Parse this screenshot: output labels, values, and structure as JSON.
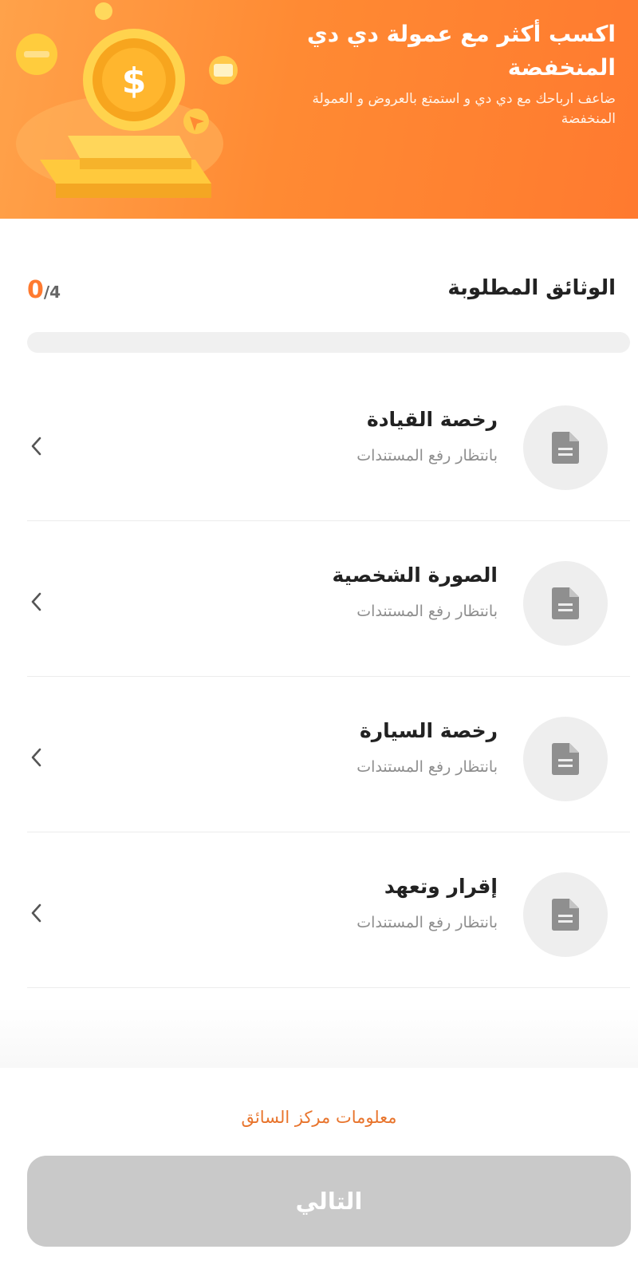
{
  "banner": {
    "title": "اكسب أكثر مع عمولة دي دي المنخفضة",
    "subtitle": "ضاعف ارباحك مع دي دي و استمتع بالعروض و العمولة المنخفضة",
    "illustration": "coin-dollar-illustration",
    "colors": {
      "gradient_start": "#ffa24a",
      "gradient_end": "#ff7a2f"
    }
  },
  "requirements": {
    "title": "الوثائق المطلوبة",
    "completed": "0",
    "total": "/4",
    "progress_fraction": 0
  },
  "documents": [
    {
      "title": "رخصة القيادة",
      "status": "بانتظار رفع المستندات",
      "icon": "document-icon"
    },
    {
      "title": "الصورة الشخصية",
      "status": "بانتظار رفع المستندات",
      "icon": "document-icon"
    },
    {
      "title": "رخصة السيارة",
      "status": "بانتظار رفع المستندات",
      "icon": "document-icon"
    },
    {
      "title": "إقرار وتعهد",
      "status": "بانتظار رفع المستندات",
      "icon": "document-icon"
    }
  ],
  "footer": {
    "driver_center_link": "معلومات مركز السائق",
    "next_button": "التالي",
    "next_enabled": false
  },
  "colors": {
    "accent": "#ff7a2f",
    "link": "#e8742c",
    "disabled_button": "#c9c9c9"
  }
}
